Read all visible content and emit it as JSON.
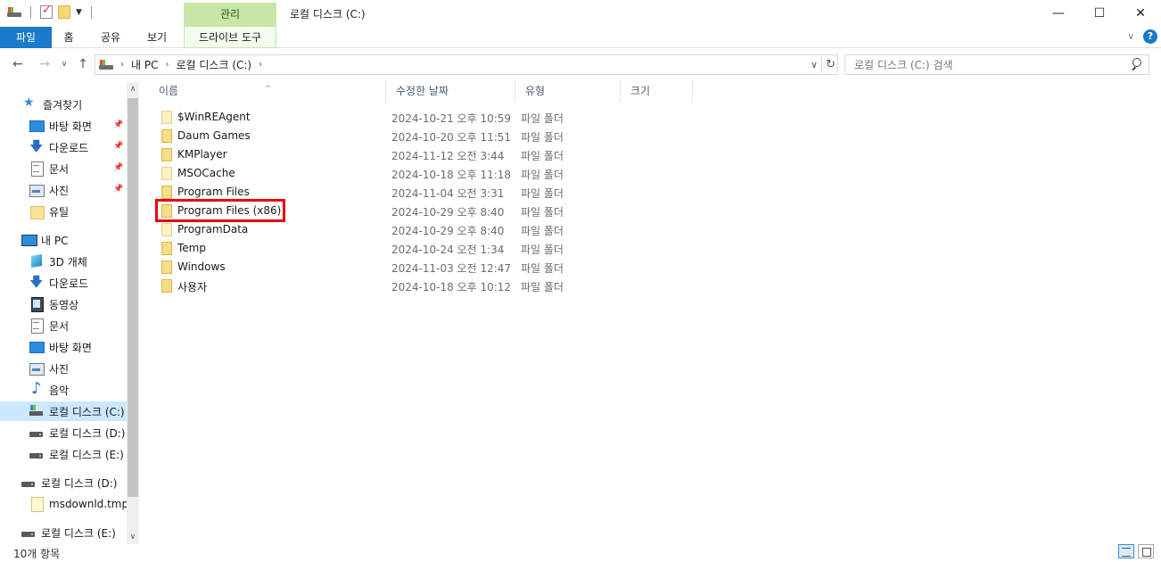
{
  "window": {
    "title": "로컬 디스크 (C:)",
    "context_tab_group": "관리",
    "controls": {
      "minimize": "—",
      "maximize": "☐",
      "close": "✕"
    }
  },
  "ribbon": {
    "tabs": [
      "파일",
      "홈",
      "공유",
      "보기",
      "드라이브 도구"
    ],
    "help_label": "?"
  },
  "address": {
    "crumbs": [
      "내 PC",
      "로컬 디스크 (C:)"
    ],
    "search_placeholder": "로컬 디스크 (C:) 검색"
  },
  "sidebar": {
    "quick_access": "즐겨찾기",
    "items": [
      {
        "label": "즐겨찾기",
        "icon": "star-icon"
      },
      {
        "label": "바탕 화면",
        "icon": "desktop-icon",
        "pinned": true
      },
      {
        "label": "다운로드",
        "icon": "download-icon",
        "pinned": true
      },
      {
        "label": "문서",
        "icon": "document-icon",
        "pinned": true
      },
      {
        "label": "사진",
        "icon": "picture-icon",
        "pinned": true
      },
      {
        "label": "유틸",
        "icon": "folder-icon"
      },
      {
        "label": "내 PC",
        "icon": "computer-icon"
      },
      {
        "label": "3D 개체",
        "icon": "3d-objects-icon"
      },
      {
        "label": "다운로드",
        "icon": "download-icon"
      },
      {
        "label": "동영상",
        "icon": "video-icon"
      },
      {
        "label": "문서",
        "icon": "document-icon"
      },
      {
        "label": "바탕 화면",
        "icon": "desktop-icon"
      },
      {
        "label": "사진",
        "icon": "picture-icon"
      },
      {
        "label": "음악",
        "icon": "music-icon"
      },
      {
        "label": "로컬 디스크 (C:)",
        "icon": "system-drive-icon",
        "selected": true
      },
      {
        "label": "로컬 디스크 (D:)",
        "icon": "drive-icon"
      },
      {
        "label": "로컬 디스크 (E:)",
        "icon": "drive-icon"
      },
      {
        "label": "로컬 디스크 (D:)",
        "icon": "drive-icon"
      },
      {
        "label": "msdownld.tmp",
        "icon": "file-icon"
      },
      {
        "label": "로컬 디스크 (E:)",
        "icon": "drive-icon"
      }
    ]
  },
  "columns": [
    "이름",
    "수정한 날짜",
    "유형",
    "크기"
  ],
  "files": [
    {
      "name": "$WinREAgent",
      "date": "2024-10-21 오후 10:59",
      "type": "파일 폴더",
      "hidden": true
    },
    {
      "name": "Daum Games",
      "date": "2024-10-20 오후 11:51",
      "type": "파일 폴더"
    },
    {
      "name": "KMPlayer",
      "date": "2024-11-12 오전 3:44",
      "type": "파일 폴더"
    },
    {
      "name": "MSOCache",
      "date": "2024-10-18 오후 11:18",
      "type": "파일 폴더",
      "hidden": true
    },
    {
      "name": "Program Files",
      "date": "2024-11-04 오전 3:31",
      "type": "파일 폴더"
    },
    {
      "name": "Program Files (x86)",
      "date": "2024-10-29 오후 8:40",
      "type": "파일 폴더",
      "highlighted": true
    },
    {
      "name": "ProgramData",
      "date": "2024-10-29 오후 8:40",
      "type": "파일 폴더",
      "hidden": true
    },
    {
      "name": "Temp",
      "date": "2024-10-24 오전 1:34",
      "type": "파일 폴더"
    },
    {
      "name": "Windows",
      "date": "2024-11-03 오전 12:47",
      "type": "파일 폴더"
    },
    {
      "name": "사용자",
      "date": "2024-10-18 오후 10:12",
      "type": "파일 폴더"
    }
  ],
  "status": {
    "item_count": "10개 항목"
  },
  "colors": {
    "accent": "#1979ca",
    "context_tab": "#c8e6a6",
    "selection": "#cce8ff",
    "highlight_box": "#e8000b"
  }
}
